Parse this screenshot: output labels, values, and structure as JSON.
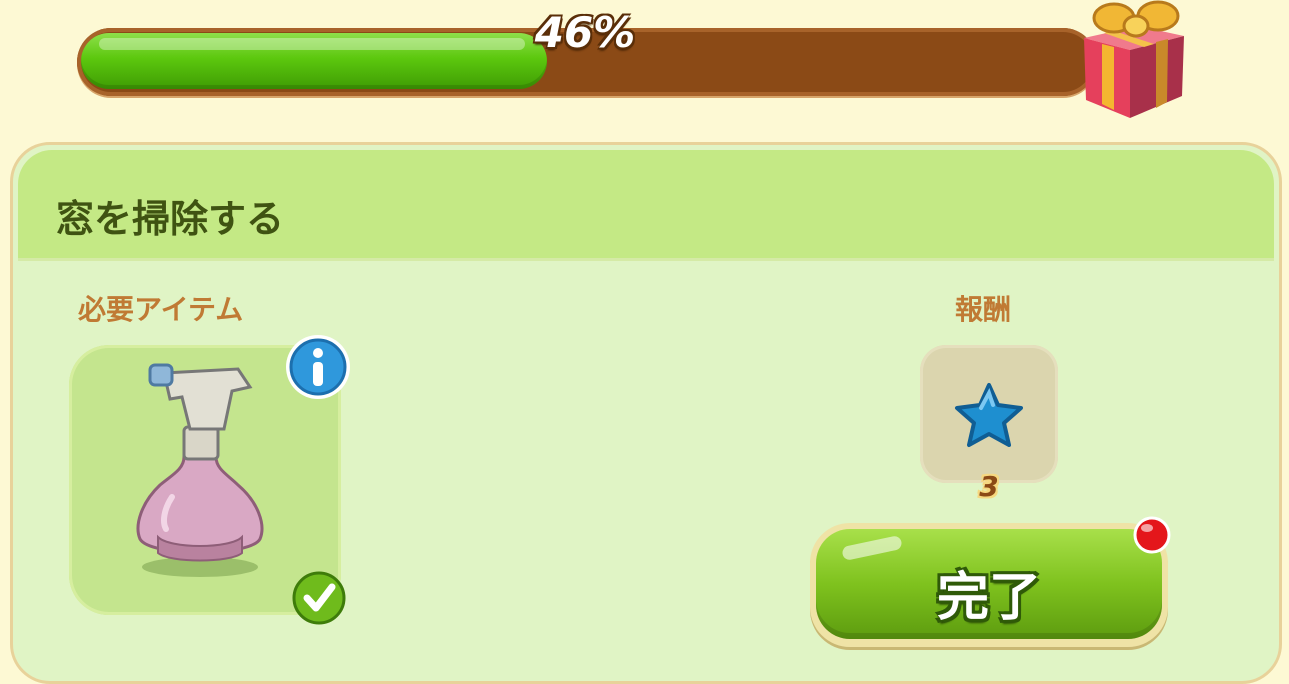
{
  "progress": {
    "value_percent": 46,
    "label": "46%",
    "fill_color": "#5cc80e",
    "track_color": "#8b4a16"
  },
  "chest_reward_icon": "gift-box-icon",
  "task": {
    "title": "窓を掃除する",
    "required_items_label": "必要アイテム",
    "required_item": {
      "icon": "spray-bottle-icon",
      "info_icon": "info-icon",
      "status_icon": "checkmark-icon",
      "collected": true
    },
    "reward_label": "報酬",
    "reward": {
      "icon": "blue-star-icon",
      "count": "3"
    },
    "complete_button_label": "完了",
    "notification_icon": "red-dot-icon"
  }
}
